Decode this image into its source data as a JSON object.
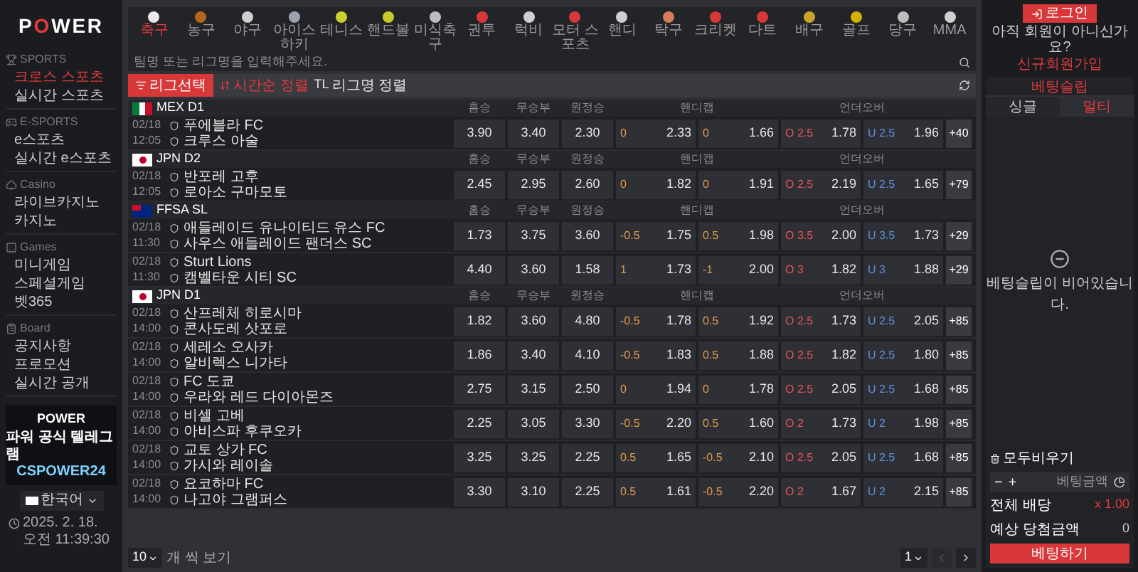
{
  "logo": [
    {
      "text": "P",
      "accent": false
    },
    {
      "text": "O",
      "accent": true
    },
    {
      "text": "WER",
      "accent": false
    }
  ],
  "sidebar": {
    "sections": [
      {
        "title": "SPORTS",
        "items": [
          {
            "label": "크로스 스포츠",
            "selected": true
          },
          {
            "label": "실시간 스포츠",
            "selected": false
          }
        ]
      },
      {
        "title": "E-SPORTS",
        "items": [
          {
            "label": "e스포츠",
            "selected": false
          },
          {
            "label": "실시간 e스포츠",
            "selected": false
          }
        ]
      },
      {
        "title": "Casino",
        "items": [
          {
            "label": "라이브카지노 카지노",
            "selected": false
          }
        ]
      },
      {
        "title": "Games",
        "items": [
          {
            "label": "미니게임",
            "selected": false
          },
          {
            "label": "스페셜게임",
            "selected": false
          },
          {
            "label": "벳365",
            "selected": false
          }
        ]
      },
      {
        "title": "Board",
        "items": [
          {
            "label": "공지사항",
            "selected": false
          },
          {
            "label": "프로모션",
            "selected": false
          },
          {
            "label": "실시간 공개",
            "selected": false
          }
        ]
      }
    ]
  },
  "banner": {
    "logo": "POWER",
    "title": "파워 공식 텔레그램",
    "handle": "CSPOWER24"
  },
  "language": "한국어",
  "clock": "2025. 2. 18. 오전 11:39:30",
  "sports": [
    {
      "label": "축구",
      "selected": true
    },
    {
      "label": "농구",
      "selected": false
    },
    {
      "label": "야구",
      "selected": false
    },
    {
      "label": "아이스 하키",
      "selected": false
    },
    {
      "label": "테니스",
      "selected": false
    },
    {
      "label": "핸드볼",
      "selected": false
    },
    {
      "label": "미식축구",
      "selected": false
    },
    {
      "label": "권투",
      "selected": false
    },
    {
      "label": "럭비",
      "selected": false
    },
    {
      "label": "모터 스포츠",
      "selected": false
    },
    {
      "label": "핸디",
      "selected": false
    },
    {
      "label": "탁구",
      "selected": false
    },
    {
      "label": "크리켓",
      "selected": false
    },
    {
      "label": "다트",
      "selected": false
    },
    {
      "label": "배구",
      "selected": false
    },
    {
      "label": "골프",
      "selected": false
    },
    {
      "label": "당구",
      "selected": false
    },
    {
      "label": "MMA",
      "selected": false
    }
  ],
  "search": {
    "placeholder": "팀명 또는 리그명을 입력해주세요."
  },
  "filters": {
    "league_button": "리그선택",
    "sorts": [
      {
        "label": "시간순 정렬",
        "selected": true
      },
      {
        "label": "리그명 정렬",
        "mark": "TL",
        "selected": false
      }
    ]
  },
  "leagues": [
    {
      "name": "MEX D1",
      "columns": [
        "홈승",
        "무승부",
        "원정승",
        "핸디캡",
        "언더오버"
      ],
      "matches": [
        {
          "date": "02/18",
          "time": "12:05",
          "home": "푸에블라 FC",
          "away": "크루스 아술",
          "odds": [
            "3.90",
            "3.40",
            "2.30"
          ],
          "handicap": [
            {
              "line": "0",
              "odd": "2.33"
            },
            {
              "line": "0",
              "odd": "1.66"
            }
          ],
          "over_under": [
            {
              "line": "O 2.5",
              "odd": "1.78"
            },
            {
              "line": "U 2.5",
              "odd": "1.96"
            }
          ],
          "more": "+40"
        }
      ]
    },
    {
      "name": "JPN D2",
      "columns": [
        "홈승",
        "무승부",
        "원정승",
        "핸디캡",
        "언더오버"
      ],
      "matches": [
        {
          "date": "02/18",
          "time": "12:05",
          "home": "반포레 고후",
          "away": "로아소 구마모토",
          "odds": [
            "2.45",
            "2.95",
            "2.60"
          ],
          "handicap": [
            {
              "line": "0",
              "odd": "1.82"
            },
            {
              "line": "0",
              "odd": "1.91"
            }
          ],
          "over_under": [
            {
              "line": "O 2.5",
              "odd": "2.19"
            },
            {
              "line": "U 2.5",
              "odd": "1.65"
            }
          ],
          "more": "+79"
        }
      ]
    },
    {
      "name": "FFSA SL",
      "columns": [
        "홈승",
        "무승부",
        "원정승",
        "핸디캡",
        "언더오버"
      ],
      "matches": [
        {
          "date": "02/18",
          "time": "11:30",
          "home": "애들레이드 유나이티드 유스 FC",
          "away": "사우스 애들레이드 팬더스 SC",
          "odds": [
            "1.73",
            "3.75",
            "3.60"
          ],
          "handicap": [
            {
              "line": "-0.5",
              "odd": "1.75"
            },
            {
              "line": "0.5",
              "odd": "1.98"
            }
          ],
          "over_under": [
            {
              "line": "O 3.5",
              "odd": "2.00"
            },
            {
              "line": "U 3.5",
              "odd": "1.73"
            }
          ],
          "more": "+29"
        },
        {
          "date": "02/18",
          "time": "11:30",
          "home": "Sturt Lions",
          "away": "캠벨타운 시티 SC",
          "odds": [
            "4.40",
            "3.60",
            "1.58"
          ],
          "handicap": [
            {
              "line": "1",
              "odd": "1.73"
            },
            {
              "line": "-1",
              "odd": "2.00"
            }
          ],
          "over_under": [
            {
              "line": "O 3",
              "odd": "1.82"
            },
            {
              "line": "U 3",
              "odd": "1.88"
            }
          ],
          "more": "+29"
        }
      ]
    },
    {
      "name": "JPN D1",
      "columns": [
        "홈승",
        "무승부",
        "원정승",
        "핸디캡",
        "언더오버"
      ],
      "matches": [
        {
          "date": "02/18",
          "time": "14:00",
          "home": "산프레체 히로시마",
          "away": "콘사도레 삿포로",
          "odds": [
            "1.82",
            "3.60",
            "4.80"
          ],
          "handicap": [
            {
              "line": "-0.5",
              "odd": "1.78"
            },
            {
              "line": "0.5",
              "odd": "1.92"
            }
          ],
          "over_under": [
            {
              "line": "O 2.5",
              "odd": "1.73"
            },
            {
              "line": "U 2.5",
              "odd": "2.05"
            }
          ],
          "more": "+85"
        },
        {
          "date": "02/18",
          "time": "14:00",
          "home": "세레소 오사카",
          "away": "알비렉스 니가타",
          "odds": [
            "1.86",
            "3.40",
            "4.10"
          ],
          "handicap": [
            {
              "line": "-0.5",
              "odd": "1.83"
            },
            {
              "line": "0.5",
              "odd": "1.88"
            }
          ],
          "over_under": [
            {
              "line": "O 2.5",
              "odd": "1.82"
            },
            {
              "line": "U 2.5",
              "odd": "1.80"
            }
          ],
          "more": "+85"
        },
        {
          "date": "02/18",
          "time": "14:00",
          "home": "FC 도쿄",
          "away": "우라와 레드 다이아몬즈",
          "odds": [
            "2.75",
            "3.15",
            "2.50"
          ],
          "handicap": [
            {
              "line": "0",
              "odd": "1.94"
            },
            {
              "line": "0",
              "odd": "1.78"
            }
          ],
          "over_under": [
            {
              "line": "O 2.5",
              "odd": "2.05"
            },
            {
              "line": "U 2.5",
              "odd": "1.68"
            }
          ],
          "more": "+85"
        },
        {
          "date": "02/18",
          "time": "14:00",
          "home": "비셀 고베",
          "away": "아비스파 후쿠오카",
          "odds": [
            "2.25",
            "3.05",
            "3.30"
          ],
          "handicap": [
            {
              "line": "-0.5",
              "odd": "2.20"
            },
            {
              "line": "0.5",
              "odd": "1.60"
            }
          ],
          "over_under": [
            {
              "line": "O 2",
              "odd": "1.73"
            },
            {
              "line": "U 2",
              "odd": "1.98"
            }
          ],
          "more": "+85"
        },
        {
          "date": "02/18",
          "time": "14:00",
          "home": "교토 상가 FC",
          "away": "가시와 레이솔",
          "odds": [
            "3.25",
            "3.25",
            "2.25"
          ],
          "handicap": [
            {
              "line": "0.5",
              "odd": "1.65"
            },
            {
              "line": "-0.5",
              "odd": "2.10"
            }
          ],
          "over_under": [
            {
              "line": "O 2.5",
              "odd": "2.05"
            },
            {
              "line": "U 2.5",
              "odd": "1.68"
            }
          ],
          "more": "+85"
        },
        {
          "date": "02/18",
          "time": "14:00",
          "home": "요코하마 FC",
          "away": "나고야 그램퍼스",
          "odds": [
            "3.30",
            "3.10",
            "2.25"
          ],
          "handicap": [
            {
              "line": "0.5",
              "odd": "1.61"
            },
            {
              "line": "-0.5",
              "odd": "2.20"
            }
          ],
          "over_under": [
            {
              "line": "O 2",
              "odd": "1.67"
            },
            {
              "line": "U 2",
              "odd": "2.15"
            }
          ],
          "more": "+85"
        }
      ]
    }
  ],
  "pager": {
    "size": "10",
    "size_label": "개 씩 보기",
    "page": "1"
  },
  "account": {
    "login": "로그인",
    "prompt": "아직 회원이 아니신가요?",
    "signup": "신규회원가입"
  },
  "betslip": {
    "title": "베팅슬립",
    "tabs": [
      {
        "label": "싱글",
        "selected": false
      },
      {
        "label": "멀티",
        "selected": true
      }
    ],
    "empty": "베팅슬립이 비어있습니다.",
    "clear": {
      "label": "모두비우기",
      "checked": false
    },
    "minus": "−",
    "plus": "+",
    "amount_placeholder": "베팅금액",
    "total_label": "전체 배당",
    "total": "x 1.00",
    "expected_label": "예상 당첨금액",
    "expected": "0",
    "submit": "베팅하기"
  }
}
